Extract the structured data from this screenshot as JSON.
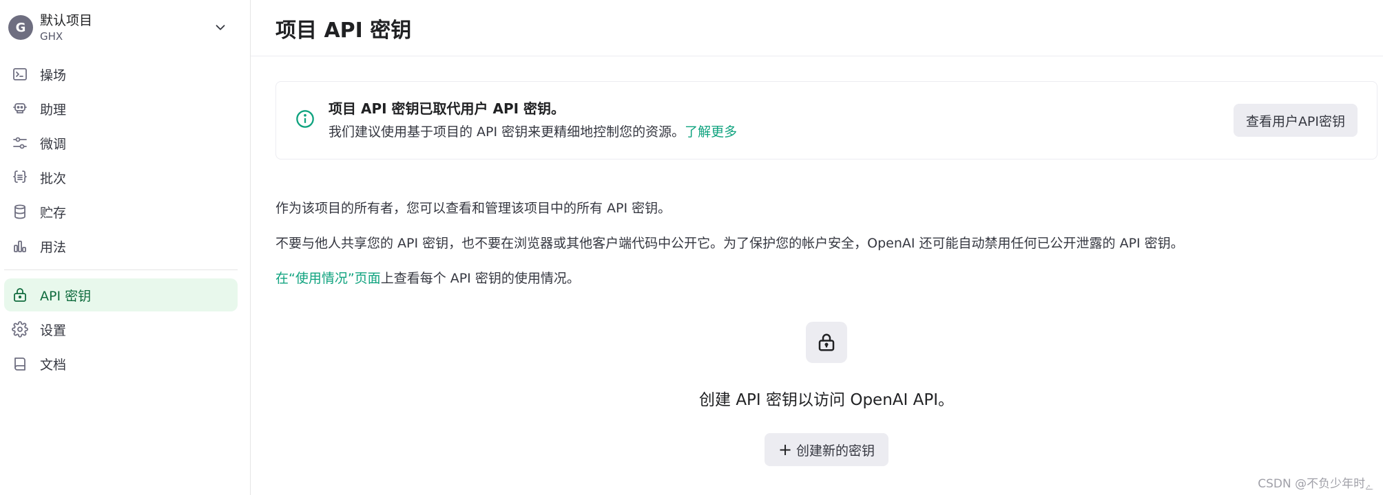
{
  "project": {
    "avatar_letter": "G",
    "name": "默认项目",
    "org": "GHX"
  },
  "sidebar": {
    "items": [
      {
        "label": "操场",
        "icon": "terminal-icon"
      },
      {
        "label": "助理",
        "icon": "robot-icon"
      },
      {
        "label": "微调",
        "icon": "sliders-icon"
      },
      {
        "label": "批次",
        "icon": "braces-icon"
      },
      {
        "label": "贮存",
        "icon": "database-icon"
      },
      {
        "label": "用法",
        "icon": "bar-chart-icon"
      }
    ],
    "bottom_items": [
      {
        "label": "API 密钥",
        "icon": "lock-icon",
        "active": true
      },
      {
        "label": "设置",
        "icon": "gear-icon"
      },
      {
        "label": "文档",
        "icon": "book-icon"
      }
    ]
  },
  "header": {
    "title": "项目 API 密钥"
  },
  "notice": {
    "title": "项目 API 密钥已取代用户 API 密钥。",
    "body": "我们建议使用基于项目的 API 密钥来更精细地控制您的资源。",
    "link": "了解更多",
    "button": "查看用户API密钥"
  },
  "paragraphs": {
    "p1": "作为该项目的所有者，您可以查看和管理该项目中的所有 API 密钥。",
    "p2": "不要与他人共享您的 API 密钥，也不要在浏览器或其他客户端代码中公开它。为了保护您的帐户安全，OpenAI 还可能自动禁用任何已公开泄露的 API 密钥。",
    "p3_link": "在“使用情况”页面",
    "p3_rest": "上查看每个 API 密钥的使用情况。"
  },
  "empty_state": {
    "text": "创建 API 密钥以访问 OpenAI API。",
    "button_plus": "+",
    "button": "创建新的密钥"
  },
  "watermark": "CSDN @不负少年时ﮮ",
  "colors": {
    "accent": "#10a37f",
    "active_bg": "#e8f8ec",
    "active_fg": "#0f6b3d"
  }
}
